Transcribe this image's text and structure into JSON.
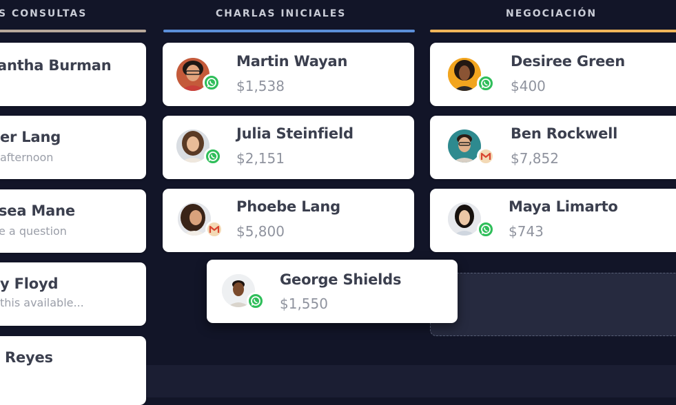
{
  "columns": [
    {
      "title": "S CONSULTAS",
      "accent": "#b8a89a"
    },
    {
      "title": "CHARLAS INICIALES",
      "accent": "#5b8fd9"
    },
    {
      "title": "NEGOCIACIÓN",
      "accent": "#f0b55a"
    }
  ],
  "consultas": [
    {
      "name": "antha Burman",
      "sub": ""
    },
    {
      "name": "er Lang",
      "sub": "afternoon"
    },
    {
      "name": "sea Mane",
      "sub": "e a question"
    },
    {
      "name": "y Floyd",
      "sub": "this available..."
    },
    {
      "name": "Reyes",
      "sub": ""
    }
  ],
  "charlas": [
    {
      "name": "Martin Wayan",
      "amount": "$1,538",
      "channel": "whatsapp-icon"
    },
    {
      "name": "Julia Steinfield",
      "amount": "$2,151",
      "channel": "whatsapp-icon"
    },
    {
      "name": "Phoebe Lang",
      "amount": "$5,800",
      "channel": "gmail-icon"
    }
  ],
  "dragged": {
    "name": "George Shields",
    "amount": "$1,550",
    "channel": "whatsapp-icon"
  },
  "negociacion": [
    {
      "name": "Desiree Green",
      "amount": "$400",
      "channel": "whatsapp-icon"
    },
    {
      "name": "Ben Rockwell",
      "amount": "$7,852",
      "channel": "gmail-icon"
    },
    {
      "name": "Maya Limarto",
      "amount": "$743",
      "channel": "whatsapp-icon"
    }
  ],
  "colors": {
    "background": "#121528",
    "whatsapp": "#2fbe5a",
    "gmail_red": "#d9442f"
  }
}
